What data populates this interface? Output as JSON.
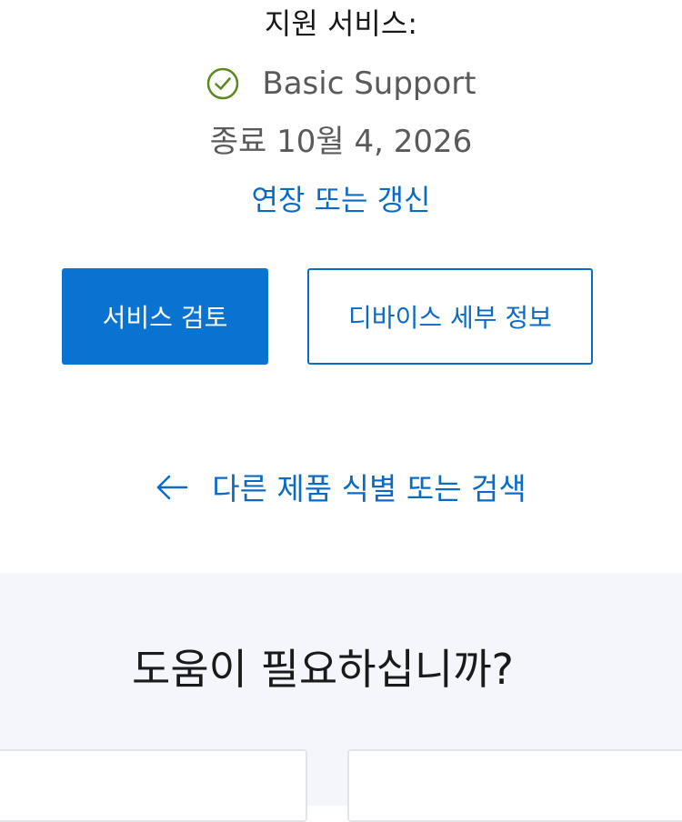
{
  "support": {
    "heading": "지원 서비스:",
    "plan_name": "Basic Support",
    "expiry": "종료 10월 4, 2026",
    "renew_link": "연장 또는 갱신"
  },
  "actions": {
    "review_service_label": "서비스 검토",
    "device_details_label": "디바이스 세부 정보"
  },
  "navigation": {
    "back_link": "다른 제품 식별 또는 검색"
  },
  "help": {
    "title": "도움이 필요하십니까?"
  },
  "colors": {
    "link_blue": "#0a6bc7",
    "primary_button": "#0a73d1",
    "check_green": "#5a8a1f",
    "help_bg": "#f5f6fb"
  },
  "icons": {
    "check": "check-circle-icon",
    "back": "arrow-left-icon"
  }
}
